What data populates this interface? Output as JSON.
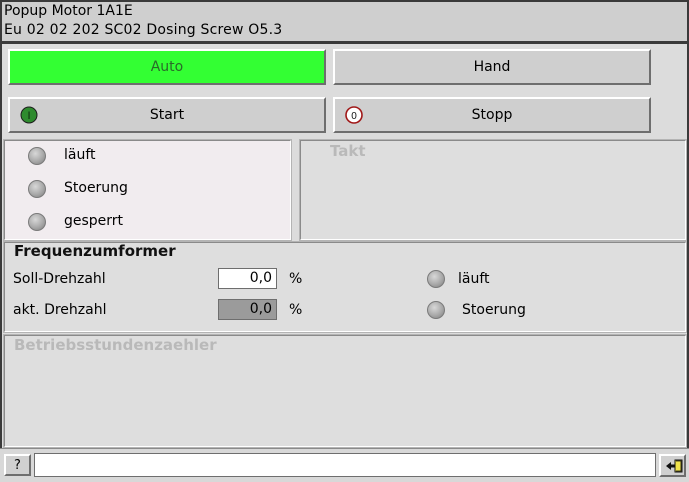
{
  "window": {
    "title_line1": "Popup Motor 1A1E",
    "title_line2": "Eu  02  02  202 SC02 Dosing Screw O5.3"
  },
  "mode_buttons": {
    "auto": "Auto",
    "hand": "Hand"
  },
  "control_buttons": {
    "start": "Start",
    "start_icon": "I",
    "stop": "Stopp",
    "stop_icon": "0"
  },
  "status_panel": {
    "items": [
      "läuft",
      "Stoerung",
      "gesperrt"
    ]
  },
  "takt_panel": {
    "title": "Takt"
  },
  "frequency_converter": {
    "title": "Frequenzumformer",
    "soll_label": "Soll-Drehzahl",
    "soll_value": "0,0",
    "soll_unit": "%",
    "akt_label": "akt. Drehzahl",
    "akt_value": "0,0",
    "akt_unit": "%",
    "indicators": [
      "läuft",
      "Stoerung"
    ]
  },
  "hours_counter": {
    "title": "Betriebsstundenzaehler"
  },
  "status_bar": {
    "help": "?",
    "message": "",
    "ack_icon": "acknowledge-icon"
  },
  "colors": {
    "auto_active": "#33ff33",
    "start_icon": "#2e8b2e",
    "stop_icon": "#a01818"
  }
}
